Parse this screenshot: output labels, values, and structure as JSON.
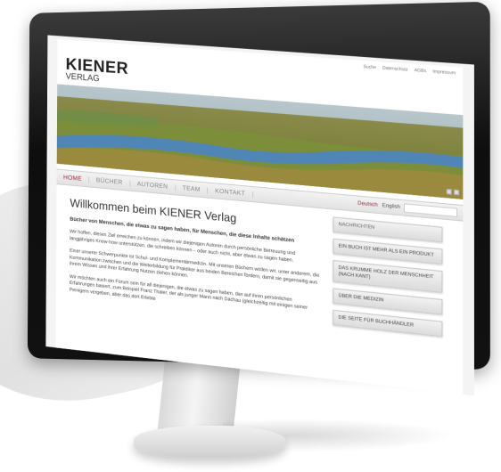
{
  "top_links": [
    "Suche",
    "Datenschutz",
    "AGBs",
    "Impressum"
  ],
  "logo": {
    "name": "KIENER",
    "subtitle": "VERLAG"
  },
  "nav": [
    {
      "label": "HOME",
      "active": true
    },
    {
      "label": "BÜCHER",
      "active": false
    },
    {
      "label": "AUTOREN",
      "active": false
    },
    {
      "label": "TEAM",
      "active": false
    },
    {
      "label": "KONTAKT",
      "active": false
    }
  ],
  "languages": {
    "de": "Deutsch",
    "en": "English"
  },
  "main": {
    "title": "Willkommen beim KIENER Verlag",
    "lead": "Bücher von Menschen, die etwas zu sagen haben, für Menschen, die diese Inhalte schätzen",
    "paragraphs": [
      "Wir hoffen, dieses Ziel erreichen zu können, indem wir diejenigen Autoren durch persönliche Betreuung und langjähriges Know-how unterstützen, die schreiben können – oder auch nicht, aber etwas zu sagen haben.",
      "Einer unserer Schwerpunkte ist Schul- und Komplementärmedizin. Mit unseren Büchern wollen wir, unter anderem, die Kommunikation zwischen und die Weiterbildung für Praktiker aus beiden Bereichen fördern, damit sie gegenseitig aus ihrem Wissen und ihrer Erfahrung Nutzen ziehen können.",
      "Wir möchten auch ein Forum sein für all diejenigen, die etwas zu sagen haben, das auf ihren persönlichen Erfahrungen basiert, zum Beispiel Franz Thaler, der als junger Mann nach Dachau (gleichzeitig mit einigen seiner Peinigern vergeben, aber das dort Erlebte"
    ]
  },
  "sidebar": [
    "NACHRICHTEN",
    "EIN BUCH IST MEHR ALS EIN PRODUKT",
    "DAS KRUMME HOLZ DER MENSCHHEIT (NACH KANT)",
    "ÜBER DIE MEDIZIN",
    "DIE SEITE FÜR BUCHHÄNDLER"
  ]
}
